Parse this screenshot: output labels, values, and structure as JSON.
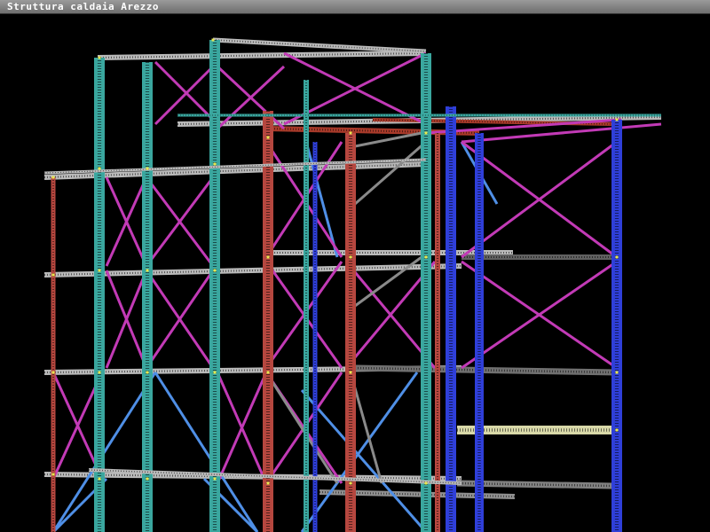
{
  "window": {
    "title": "Struttura caldaia Arezzo"
  },
  "colors": {
    "background": "#000000",
    "column_teal": "#3aa79f",
    "column_red": "#b6473f",
    "column_blue": "#2f3fd9",
    "brace_magenta": "#c23ab6",
    "brace_blue": "#4f8fe6",
    "brace_grey": "#8a8a8a",
    "beam_grey": "#b9b9b9",
    "beam_yellow": "#d8d8a8",
    "beam_red": "#a83a2a",
    "node_yellow": "#e8e850"
  },
  "icons": {
    "node_marker": "yellow-node-icon"
  }
}
